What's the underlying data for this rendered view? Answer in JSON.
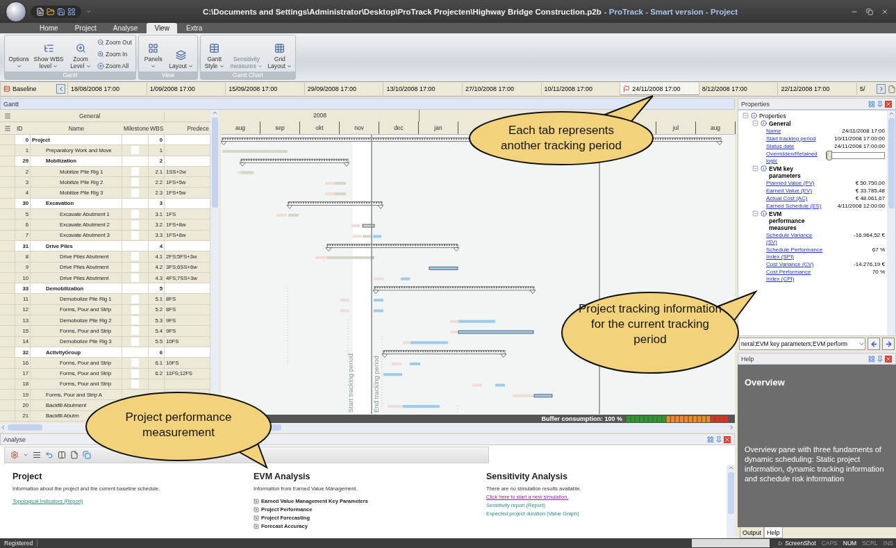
{
  "window": {
    "title_path": "C:\\Documents and Settings\\Administrator\\Desktop\\ProTrack Projecten\\Highway Bridge Construction.p2b",
    "title_app": "- ProTrack - Smart version - Project"
  },
  "ribbon_tabs": [
    {
      "label": "Home",
      "selected": false
    },
    {
      "label": "Project",
      "selected": false
    },
    {
      "label": "Analyse",
      "selected": false
    },
    {
      "label": "View",
      "selected": true
    },
    {
      "label": "Extra",
      "selected": false
    }
  ],
  "ribbon_groups": [
    {
      "label": "Gantt",
      "buttons": [
        {
          "kind": "large",
          "label": "Options",
          "dropdown": true,
          "disabled": false
        },
        {
          "kind": "large",
          "label": "Show WBS level",
          "dropdown": true,
          "disabled": false
        },
        {
          "kind": "large",
          "label": "Zoom Level",
          "dropdown": true,
          "disabled": false
        },
        {
          "kind": "stack",
          "items": [
            {
              "label": "Zoom Out"
            },
            {
              "label": "Zoom In"
            },
            {
              "label": "Zoom All"
            }
          ]
        }
      ]
    },
    {
      "label": "View",
      "buttons": [
        {
          "kind": "large",
          "label": "Panels",
          "dropdown": true,
          "disabled": false
        },
        {
          "kind": "large",
          "label": "Layout",
          "dropdown": true,
          "disabled": false
        }
      ]
    },
    {
      "label": "Gantt Chart",
      "buttons": [
        {
          "kind": "large",
          "label": "Gantt Style",
          "dropdown": true,
          "disabled": false
        },
        {
          "kind": "large",
          "label": "Sensitivity measures",
          "dropdown": true,
          "disabled": true
        },
        {
          "kind": "large",
          "label": "Grid Layout",
          "dropdown": true,
          "disabled": false
        }
      ]
    }
  ],
  "timeline": {
    "baseline": "Baseline",
    "periods": [
      {
        "label": "18/08/2008 17:00",
        "selected": false
      },
      {
        "label": "1/09/2008 17:00",
        "selected": false
      },
      {
        "label": "15/09/2008 17:00",
        "selected": false
      },
      {
        "label": "29/09/2008 17:00",
        "selected": false
      },
      {
        "label": "13/10/2008 17:00",
        "selected": false
      },
      {
        "label": "27/10/2008 17:00",
        "selected": false
      },
      {
        "label": "10/11/2008 17:00",
        "selected": false
      },
      {
        "label": "24/11/2008 17:00",
        "selected": true
      },
      {
        "label": "8/12/2008 17:00",
        "selected": false
      },
      {
        "label": "22/12/2008 17:00",
        "selected": false
      },
      {
        "label": "5/",
        "selected": false
      }
    ]
  },
  "gantt": {
    "title": "Gantt",
    "group_header": "General",
    "columns": [
      "ID",
      "Name",
      "Milestone",
      "WBS",
      "Predece"
    ],
    "rows": [
      {
        "kind": "summary",
        "id": "0",
        "name": "Project",
        "wbs": "0",
        "children": [
          {
            "kind": "task",
            "id": "1",
            "name": "Preparatory Work and Move",
            "wbs": "1",
            "milestone": false
          },
          {
            "kind": "summary",
            "id": "29",
            "name": "Mobilization",
            "wbs": "2",
            "children": [
              {
                "kind": "task",
                "id": "2",
                "name": "Mobilize Pile Rig 1",
                "wbs": "2.1",
                "pred": "1SS+2w",
                "milestone": false
              },
              {
                "kind": "task",
                "id": "3",
                "name": "Mobilize Pile Rig 2",
                "wbs": "2.2",
                "pred": "1FS+5w",
                "milestone": false
              },
              {
                "kind": "task",
                "id": "4",
                "name": "Mobilize Pile Rig 3",
                "wbs": "2.3",
                "pred": "1FS+5w",
                "milestone": false
              }
            ]
          },
          {
            "kind": "summary",
            "id": "30",
            "name": "Excavation",
            "wbs": "3",
            "children": [
              {
                "kind": "task",
                "id": "5",
                "name": "Excavate Abutment 1",
                "wbs": "3.1",
                "pred": "1FS",
                "milestone": false
              },
              {
                "kind": "task",
                "id": "6",
                "name": "Excavate Abutment 2",
                "wbs": "3.2",
                "pred": "1FS+8w",
                "milestone": false
              },
              {
                "kind": "task",
                "id": "7",
                "name": "Excavate Abutment 3",
                "wbs": "3.3",
                "pred": "1FS+8w",
                "milestone": false
              }
            ]
          },
          {
            "kind": "summary",
            "id": "31",
            "name": "Drive Piles",
            "wbs": "4",
            "children": [
              {
                "kind": "task",
                "id": "8",
                "name": "Drive Piles Abutment",
                "wbs": "4.1",
                "pred": "2FS;5FS+3w",
                "milestone": false
              },
              {
                "kind": "task",
                "id": "9",
                "name": "Drive Piles Abutment",
                "wbs": "4.2",
                "pred": "3FS;6SS+6w",
                "milestone": false
              },
              {
                "kind": "task",
                "id": "10",
                "name": "Drive Piles Abutment",
                "wbs": "4.3",
                "pred": "4FS;7SS+3w",
                "milestone": false
              }
            ]
          },
          {
            "kind": "summary",
            "id": "33",
            "name": "Demobilization",
            "wbs": "5",
            "children": [
              {
                "kind": "task",
                "id": "11",
                "name": "Demobolize Pile Rig 1",
                "wbs": "5.1",
                "pred": "8FS",
                "milestone": false
              },
              {
                "kind": "task",
                "id": "12",
                "name": "Forms, Pour and Strip",
                "wbs": "5.2",
                "pred": "8FS",
                "milestone": false
              },
              {
                "kind": "task",
                "id": "13",
                "name": "Demobolize Pile Rig 2",
                "wbs": "5.3",
                "pred": "9FS",
                "milestone": false
              },
              {
                "kind": "task",
                "id": "15",
                "name": "Forms, Pour and Strip",
                "wbs": "5.4",
                "pred": "9FS",
                "milestone": false
              },
              {
                "kind": "task",
                "id": "14",
                "name": "Demobolize Pile Rig 3",
                "wbs": "5.5",
                "pred": "10FS",
                "milestone": false
              }
            ]
          },
          {
            "kind": "summary",
            "id": "32",
            "name": "ActivityGroup",
            "wbs": "6",
            "children": [
              {
                "kind": "task",
                "id": "16",
                "name": "Forms, Pour and Strip",
                "wbs": "6.1",
                "pred": "10FS",
                "milestone": false
              },
              {
                "kind": "task",
                "id": "17",
                "name": "Forms, Pour and Strip",
                "wbs": "6.2",
                "pred": "11FS;12FS",
                "milestone": false
              },
              {
                "kind": "task",
                "id": "18",
                "name": "Forms, Pour and Strip",
                "milestone": false
              }
            ]
          },
          {
            "kind": "task",
            "id": "19",
            "name": "Forms, Pour and Strip A"
          },
          {
            "kind": "task",
            "id": "20",
            "name": "Backfill Abutment"
          },
          {
            "kind": "task",
            "id": "21",
            "name": "Backfill Abutm"
          }
        ]
      }
    ],
    "year": "2008",
    "months_left": [
      "aug",
      "sep",
      "okt",
      "nov",
      "dec",
      "jan"
    ],
    "months_right": [
      "jul",
      "aug"
    ],
    "start_label": "Start tracking period",
    "end_label": "End tracking period",
    "buffer_label": "Buffer consumption: 100 %"
  },
  "properties": {
    "title": "Properties",
    "root": {
      "label": "Properties",
      "expanded": true
    },
    "groups": [
      {
        "label": "General",
        "expanded": true,
        "items": [
          {
            "kind": "value",
            "label": "Name",
            "value": "24/11/2008 17:00"
          },
          {
            "kind": "value",
            "label": "Start tracking period",
            "value": "10/11/2008 17:00:00"
          },
          {
            "kind": "value",
            "label": "Status date",
            "value": "24/11/2008 17:00:00"
          },
          {
            "kind": "slider",
            "label": "Overridden/Retained logic",
            "level": 0
          }
        ]
      },
      {
        "label": "EVM key parameters",
        "expanded": true,
        "items": [
          {
            "kind": "value",
            "label": "Planned Value (PV)",
            "value": "€ 50.750,00"
          },
          {
            "kind": "value",
            "label": "Earned Value (EV)",
            "value": "€ 33.785,48"
          },
          {
            "kind": "value",
            "label": "Actual Cost (AC)",
            "value": "€ 48.061,67"
          },
          {
            "kind": "value",
            "label": "Earned Schedule (ES)",
            "value": "4/11/2008 12:00:00"
          }
        ]
      },
      {
        "label": "EVM performance measures",
        "expanded": true,
        "items": [
          {
            "kind": "value",
            "label": "Schedule Variance (SV)",
            "value": "-16.964,52 €"
          },
          {
            "kind": "value",
            "label": "Schedule Performance Index (SPI)",
            "value": "67 %"
          },
          {
            "kind": "value",
            "label": "Cost Variance (CV)",
            "value": "-14.276,19 €"
          },
          {
            "kind": "value",
            "label": "Cost Performance Index (CPI)",
            "value": "70 %"
          }
        ]
      }
    ],
    "filter": "neral;EVM key parameters;EVM perform"
  },
  "help": {
    "title": "Help",
    "heading": "Overview",
    "body": "Overview pane with three fundaments of dynamic scheduling: Static project information, dynamic tracking information and schedule risk information",
    "tabs": [
      {
        "label": "Output",
        "selected": false
      },
      {
        "label": "Help",
        "selected": true
      }
    ]
  },
  "analyse": {
    "title": "Analyse",
    "sections": [
      {
        "heading": "Project",
        "description": "Information about the project and the current baseline schedule.",
        "items": [
          {
            "kind": "link",
            "label": "Topological Indicators (Report)"
          }
        ]
      },
      {
        "heading": "EVM Analysis",
        "description": "Information from Earned Value Management.",
        "items": [
          {
            "kind": "expander",
            "label": "Earned Value Management Key Parameters",
            "expanded": false
          },
          {
            "kind": "expander",
            "label": "Project Performance",
            "expanded": false
          },
          {
            "kind": "expander",
            "label": "Project Forecasting",
            "expanded": false
          },
          {
            "kind": "expander",
            "label": "Forecast Accuracy",
            "expanded": false
          }
        ]
      },
      {
        "heading": "Sensitivity Analysis",
        "description": "There are no simulation results available.",
        "items": [
          {
            "kind": "action",
            "label": "Click here to start a new simulation."
          },
          {
            "kind": "report",
            "label": "Sensitivity report (Report)"
          },
          {
            "kind": "report",
            "label": "Expected project duration (Value Graph)"
          }
        ]
      }
    ]
  },
  "status_bar": {
    "left": "Registered",
    "indicators": [
      {
        "label": "ScreenShot",
        "on": true
      },
      {
        "label": "CAPS",
        "on": false
      },
      {
        "label": "NUM",
        "on": true
      },
      {
        "label": "SCRL",
        "on": false
      },
      {
        "label": "INS",
        "on": false
      }
    ]
  },
  "callouts": [
    {
      "text": "Each tab represents another tracking period"
    },
    {
      "text": "Project tracking information for the current tracking period"
    },
    {
      "text": "Project performance measurement"
    }
  ]
}
